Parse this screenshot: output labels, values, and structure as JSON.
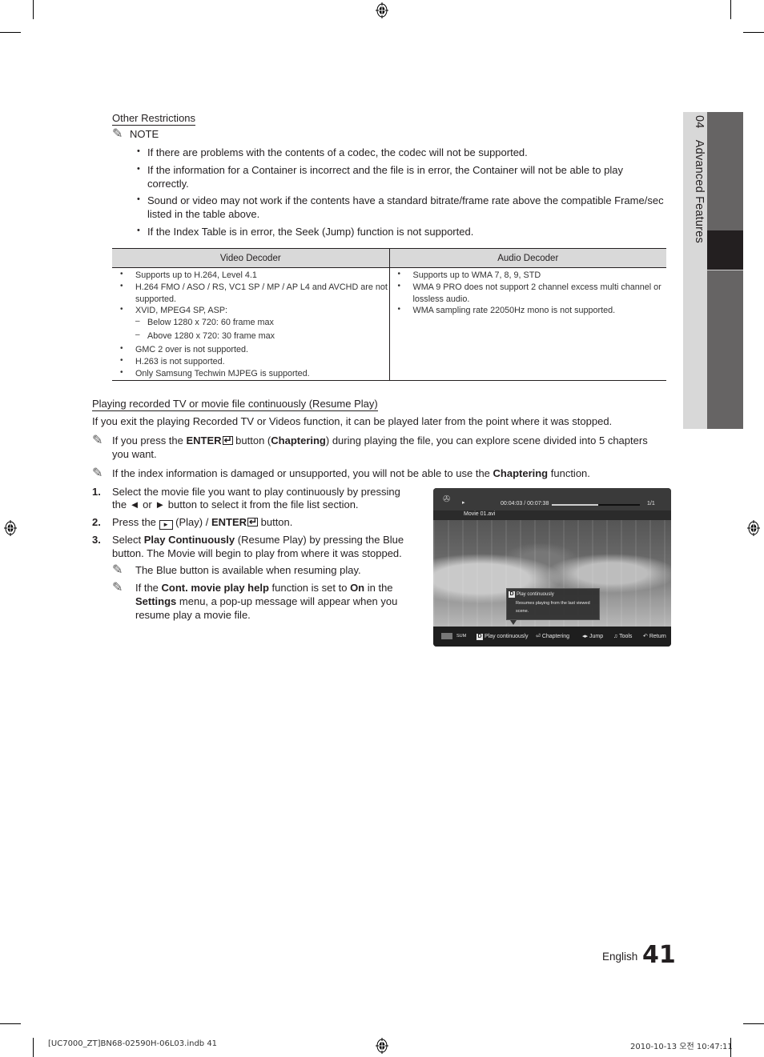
{
  "side_tab": {
    "chapter_number": "04",
    "chapter_title": "Advanced Features"
  },
  "other_restrictions": {
    "heading": "Other Restrictions",
    "note_label": "NOTE",
    "note_icon": "pencil-note-icon",
    "bullets": [
      "If there are problems with the contents of a codec, the codec will not be supported.",
      "If the information for a Container is incorrect and the file is in error, the Container will not be able to play",
      "correctly.",
      "Sound or video may not work if the contents have a standard bitrate/frame rate above the compatible Frame/sec",
      "listed in the table above.",
      "If the Index Table is in error, the Seek (Jump) function is not supported."
    ]
  },
  "decoder_table": {
    "headers": [
      "Video Decoder",
      "Audio Decoder"
    ],
    "video": [
      "Supports up to H.264, Level 4.1",
      "H.264 FMO / ASO / RS, VC1 SP / MP / AP L4 and AVCHD are not",
      "supported.",
      "XVID, MPEG4 SP, ASP:",
      "Below 1280 x 720: 60 frame max",
      "Above 1280 x 720: 30 frame max",
      "GMC 2 over is not supported.",
      "H.263 is not supported.",
      "Only Samsung Techwin MJPEG is supported."
    ],
    "audio": [
      "Supports up to WMA 7, 8, 9, STD",
      "WMA 9 PRO does not support 2 channel excess multi channel or",
      "lossless audio.",
      "WMA sampling rate 22050Hz mono is not supported."
    ]
  },
  "resume_play": {
    "heading": "Playing recorded TV or movie file continuously (Resume Play)",
    "intro": "If you exit the playing Recorded TV or Videos function, it can be played later from the point where it was stopped.",
    "note1": {
      "pre": "If you press the ",
      "enter": "ENTER",
      "mid": " button (",
      "bold": "Chaptering",
      "post": ") during playing the file, you can explore scene divided into 5 chapters",
      "line2": "you want."
    },
    "note2": {
      "pre": "If the index information is damaged or unsupported, you will not be able to use the ",
      "bold": "Chaptering",
      "post": " function."
    },
    "steps": [
      {
        "num": "1.",
        "line1": "Select the movie file you want to play continuously by pressing",
        "line2": "the ◄ or ► button to select it from the file list section."
      },
      {
        "num": "2.",
        "pre": "Press the ",
        "play_label": "(Play) / ",
        "enter": "ENTER",
        "post": " button."
      },
      {
        "num": "3.",
        "pre": "Select ",
        "bold": "Play Continuously",
        "post": " (Resume Play) by pressing the Blue",
        "line2": "button. The Movie will begin to play from where it was stopped.",
        "note_a": "The Blue button is available when resuming play.",
        "note_b": {
          "pre": "If the ",
          "bold1": "Cont. movie play help",
          "mid": " function is set to ",
          "bold2": "On",
          "post": " in the",
          "bold3": "Settings",
          "line2_post": " menu, a pop-up message will appear when you",
          "line3": "resume play a movie file."
        }
      }
    ]
  },
  "tv_screen": {
    "time": "00:04:03 / 00:07:38",
    "progress_fraction": 0.53,
    "page": "1/1",
    "filename": "Movie 01.avi",
    "popup": {
      "key": "D",
      "title": "Play continuously",
      "line1": "Resumes playing from the last viewed",
      "line2": "scene."
    },
    "bottom_bar": {
      "sum": "SUM",
      "play_key": "D",
      "play_label": "Play continuously",
      "chaptering": "Chaptering",
      "jump": "Jump",
      "tools": "Tools",
      "return": "Return"
    }
  },
  "footer": {
    "language": "English",
    "page_number": "41",
    "slug_left": "[UC7000_ZT]BN68-02590H-06L03.indb   41",
    "slug_right": "2010-10-13   오전 10:47:11"
  }
}
